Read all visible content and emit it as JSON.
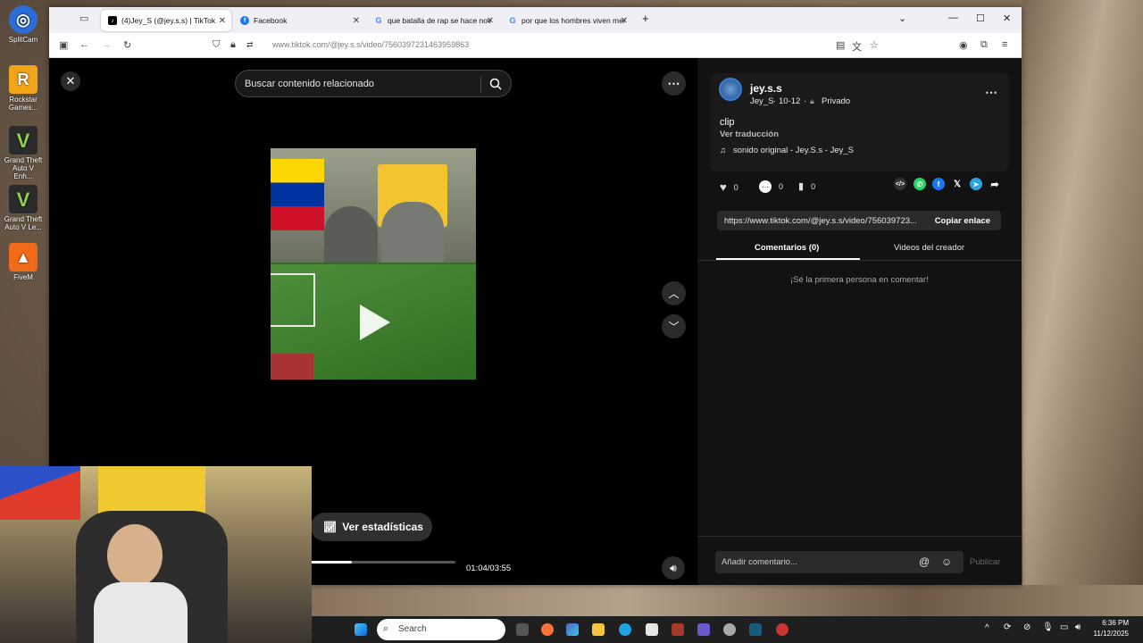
{
  "desktop": {
    "icons": [
      {
        "label": "SplitCam",
        "color": "#2b6cd6",
        "glyph": "◎"
      },
      {
        "label": "Rockstar Games...",
        "color": "#f3a51a",
        "glyph": "R"
      },
      {
        "label": "Grand Theft Auto V Enh...",
        "color": "#3a3a3a",
        "glyph": "V"
      },
      {
        "label": "Grand Theft Auto V Le...",
        "color": "#3a3a3a",
        "glyph": "V"
      },
      {
        "label": "FiveM",
        "color": "#f06a1a",
        "glyph": "▲"
      }
    ]
  },
  "browser": {
    "tabs": [
      {
        "label": "(4)Jey_S (@jey.s.s) | TikTok",
        "icon": "tiktok-icon",
        "active": true
      },
      {
        "label": "Facebook",
        "icon": "facebook-icon"
      },
      {
        "label": "que batalla de rap se hace nov",
        "icon": "google-icon"
      },
      {
        "label": "por que los hombres viven mer",
        "icon": "google-icon"
      }
    ],
    "new_tab": "+",
    "url": "www.tiktok.com/@jey.s.s/video/7560397231463959863"
  },
  "tiktok": {
    "search_placeholder": "Buscar contenido relacionado",
    "stats_button": "Ver estadísticas",
    "progress": 0.285,
    "time": "01:04/03:55",
    "author": {
      "username": "jey.s.s",
      "nickname": "Jey_S",
      "date": "10-12",
      "privacy": "Privado"
    },
    "caption": "clip",
    "translate": "Ver traducción",
    "sound": "sonido original - Jey.S.s - Jey_S",
    "likes": "0",
    "comments": "0",
    "saves": "0",
    "link": "https://www.tiktok.com/@jey.s.s/video/756039723...",
    "copy_link": "Copiar enlace",
    "tab_comments": "Comentarios (0)",
    "tab_creator": "Videos del creador",
    "empty_comments": "¡Sé la primera persona en comentar!",
    "comment_placeholder": "Añadir comentario...",
    "publish": "Publicar"
  },
  "taskbar": {
    "search": "Search",
    "time": "6:36 PM",
    "date": "11/12/2025"
  }
}
